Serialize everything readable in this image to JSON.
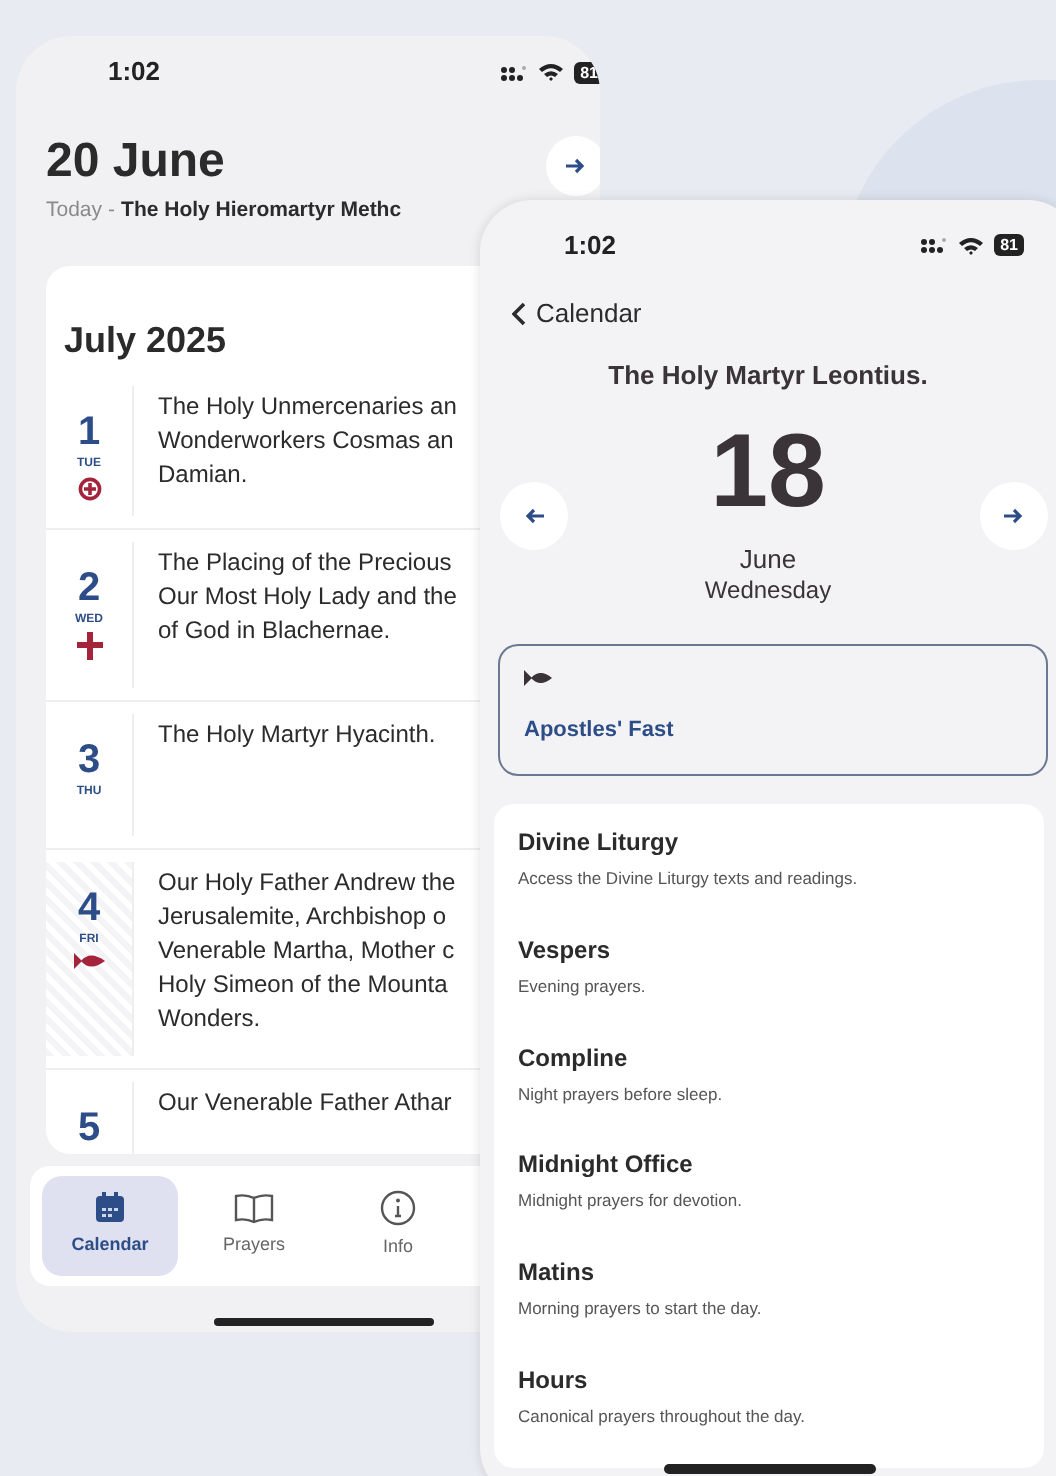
{
  "back_phone": {
    "status_bar": {
      "time": "1:02",
      "battery": "81"
    },
    "header": {
      "title": "20 June",
      "today_label": "Today",
      "separator": "-",
      "today_saint": "The Holy Hieromartyr Methc"
    },
    "calendar": {
      "month": "July 2025",
      "days": [
        {
          "day": "1",
          "weekday": "TUE",
          "kind": "feast",
          "text": "The Holy Unmercenaries an\nWonderworkers Cosmas an\nDamian."
        },
        {
          "day": "2",
          "weekday": "WED",
          "kind": "cross",
          "text": "The Placing of the Precious\nOur Most Holy Lady and the\nof God in Blachernae."
        },
        {
          "day": "3",
          "weekday": "THU",
          "kind": "plain",
          "text": "The Holy Martyr Hyacinth."
        },
        {
          "day": "4",
          "weekday": "FRI",
          "kind": "fish",
          "text": "Our Holy Father Andrew the\nJerusalemite, Archbishop o\nVenerable Martha, Mother c\nHoly Simeon of the Mounta\nWonders."
        },
        {
          "day": "5",
          "kind": "plain",
          "text": "Our Venerable Father Athar"
        }
      ]
    },
    "tabs": [
      {
        "label": "Calendar",
        "selected": true
      },
      {
        "label": "Prayers",
        "selected": false
      },
      {
        "label": "Info",
        "selected": false
      }
    ]
  },
  "front_phone": {
    "status_bar": {
      "time": "1:02",
      "battery": "81"
    },
    "back_label": "Calendar",
    "saint": "The Holy Martyr Leontius.",
    "day": "18",
    "month": "June",
    "weekday": "Wednesday",
    "fast": {
      "label": "Apostles' Fast"
    },
    "services": [
      {
        "title": "Divine Liturgy",
        "description": "Access the Divine Liturgy texts and readings."
      },
      {
        "title": "Vespers",
        "description": "Evening prayers."
      },
      {
        "title": "Compline",
        "description": "Night prayers before sleep."
      },
      {
        "title": "Midnight Office",
        "description": "Midnight prayers for devotion."
      },
      {
        "title": "Matins",
        "description": "Morning prayers to start the day."
      },
      {
        "title": "Hours",
        "description": "Canonical prayers throughout the day."
      }
    ]
  }
}
